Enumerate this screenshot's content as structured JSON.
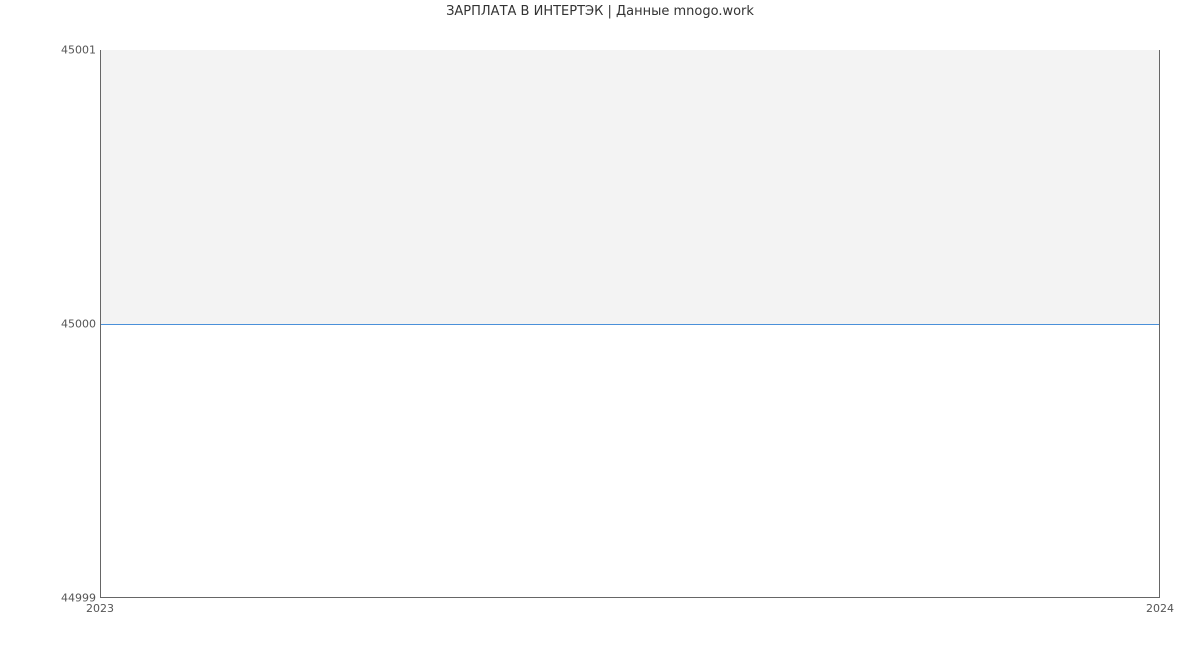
{
  "chart_data": {
    "type": "line",
    "title": "ЗАРПЛАТА В ИНТЕРТЭК | Данные mnogo.work",
    "xlabel": "",
    "ylabel": "",
    "x": [
      "2023",
      "2024"
    ],
    "values": [
      45000,
      45000
    ],
    "ylim": [
      44999,
      45001
    ],
    "yticks": [
      44999,
      45000,
      45001
    ],
    "xticks": [
      "2023",
      "2024"
    ],
    "line_color": "#4a90d9",
    "fill_above_line": true
  }
}
